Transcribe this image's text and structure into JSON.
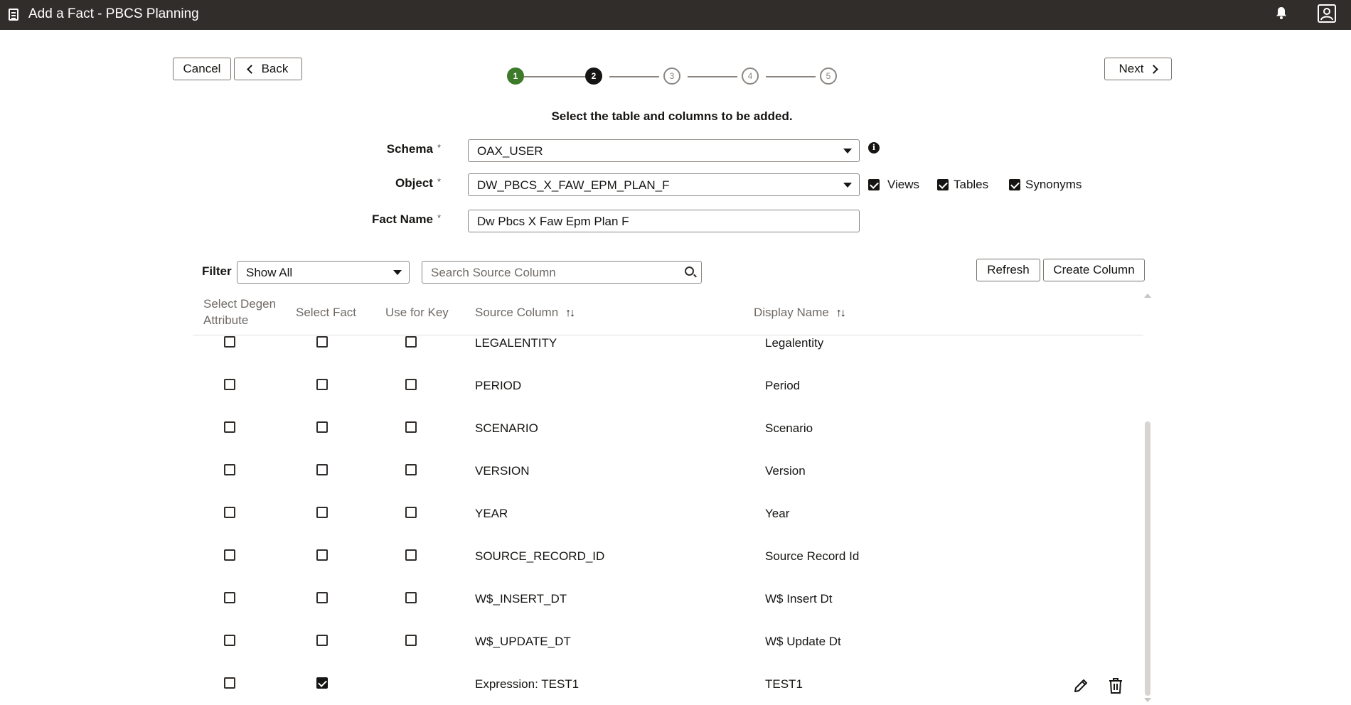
{
  "window": {
    "title": "Add a Fact - PBCS Planning",
    "app_icon": "calculator-icon",
    "notification_icon": "bell-icon",
    "profile_icon": "user-profile-icon"
  },
  "toolbar": {
    "cancel_label": "Cancel",
    "back_label": "Back",
    "next_label": "Next"
  },
  "train": {
    "steps": [
      "1",
      "2",
      "3",
      "4",
      "5"
    ],
    "completed": 1,
    "current": 2
  },
  "instruction": "Select the table and columns to be added.",
  "form": {
    "schema_label": "Schema",
    "schema_value": "OAX_USER",
    "object_label": "Object",
    "object_value": "DW_PBCS_X_FAW_EPM_PLAN_F",
    "fact_name_label": "Fact Name",
    "fact_name_value": "Dw Pbcs X Faw Epm Plan F",
    "required_marker": "*",
    "object_types": [
      {
        "label": "Views",
        "checked": true
      },
      {
        "label": "Tables",
        "checked": true
      },
      {
        "label": "Synonyms",
        "checked": true
      }
    ]
  },
  "filter": {
    "label": "Filter",
    "value": "Show All",
    "search_placeholder": "Search Source Column",
    "refresh_label": "Refresh",
    "create_column_label": "Create Column"
  },
  "table": {
    "headers": {
      "degen_line1": "Select Degen",
      "degen_line2": "Attribute",
      "fact": "Select Fact",
      "key": "Use for Key",
      "source": "Source Column",
      "display": "Display Name"
    },
    "rows": [
      {
        "source": "LEGALENTITY",
        "display": "Legalentity",
        "degen": false,
        "fact": false,
        "key": false
      },
      {
        "source": "PERIOD",
        "display": "Period",
        "degen": false,
        "fact": false,
        "key": false
      },
      {
        "source": "SCENARIO",
        "display": "Scenario",
        "degen": false,
        "fact": false,
        "key": false
      },
      {
        "source": "VERSION",
        "display": "Version",
        "degen": false,
        "fact": false,
        "key": false
      },
      {
        "source": "YEAR",
        "display": "Year",
        "degen": false,
        "fact": false,
        "key": false
      },
      {
        "source": "SOURCE_RECORD_ID",
        "display": "Source Record Id",
        "degen": false,
        "fact": false,
        "key": false
      },
      {
        "source": "W$_INSERT_DT",
        "display": "W$ Insert Dt",
        "degen": false,
        "fact": false,
        "key": false
      },
      {
        "source": "W$_UPDATE_DT",
        "display": "W$ Update Dt",
        "degen": false,
        "fact": false,
        "key": false
      },
      {
        "source": "Expression: TEST1",
        "display": "TEST1",
        "degen": false,
        "fact": true,
        "key": null,
        "edit_icon": "pencil-icon",
        "delete_icon": "trash-icon"
      }
    ]
  }
}
